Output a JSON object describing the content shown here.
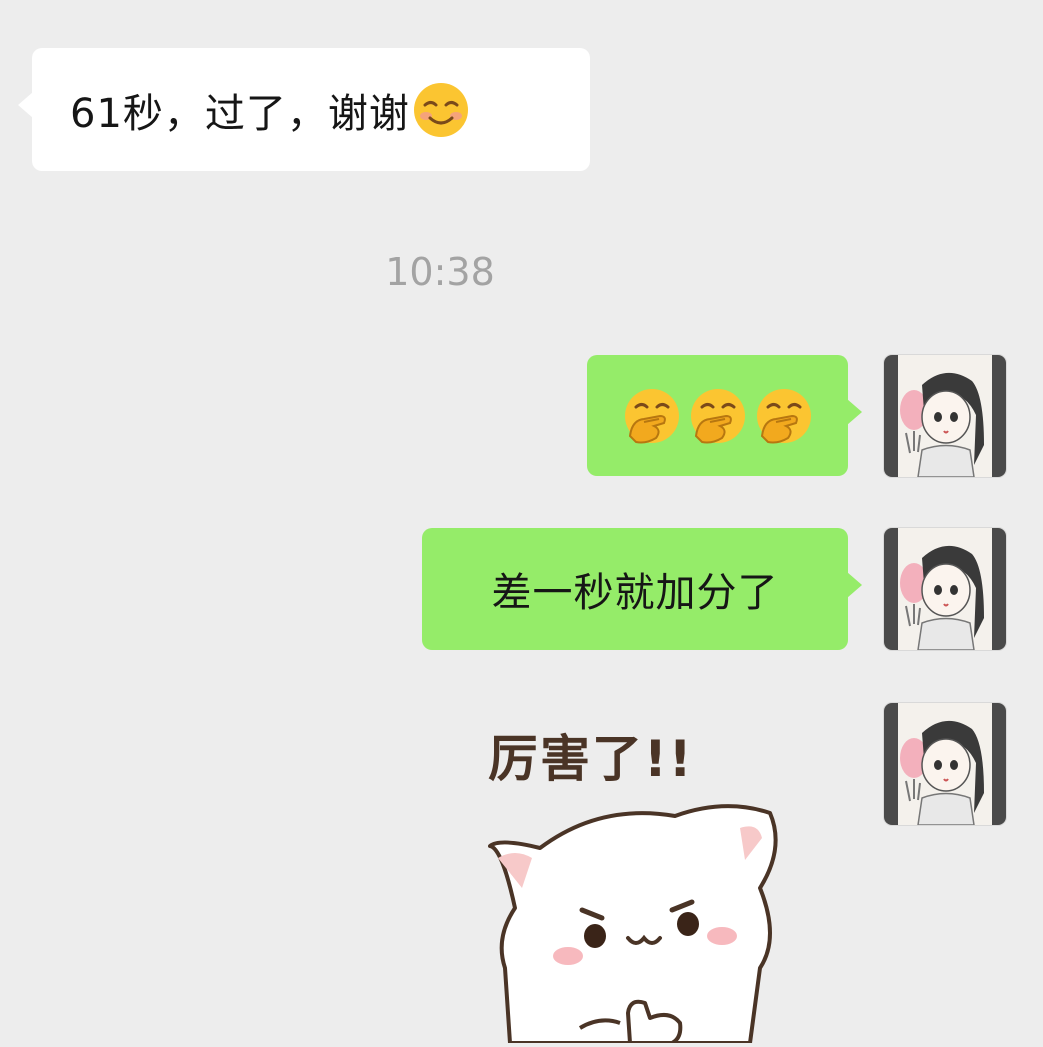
{
  "chat": {
    "messages": [
      {
        "direction": "received",
        "text": "61秒，过了，谢谢",
        "emoji": "smiling-face-with-blush"
      },
      {
        "direction": "sent",
        "emoji_sequence": [
          "hand-over-mouth-face",
          "hand-over-mouth-face",
          "hand-over-mouth-face"
        ]
      },
      {
        "direction": "sent",
        "text": "差一秒就加分了"
      },
      {
        "direction": "sent",
        "type": "sticker",
        "sticker_text": "厉害了!!",
        "sticker_name": "white-cat-thumbs-up-sticker"
      }
    ],
    "timestamp": "10:38"
  },
  "colors": {
    "background": "#ededed",
    "received_bubble": "#ffffff",
    "sent_bubble": "#95ec69",
    "timestamp": "#a3a3a3"
  }
}
